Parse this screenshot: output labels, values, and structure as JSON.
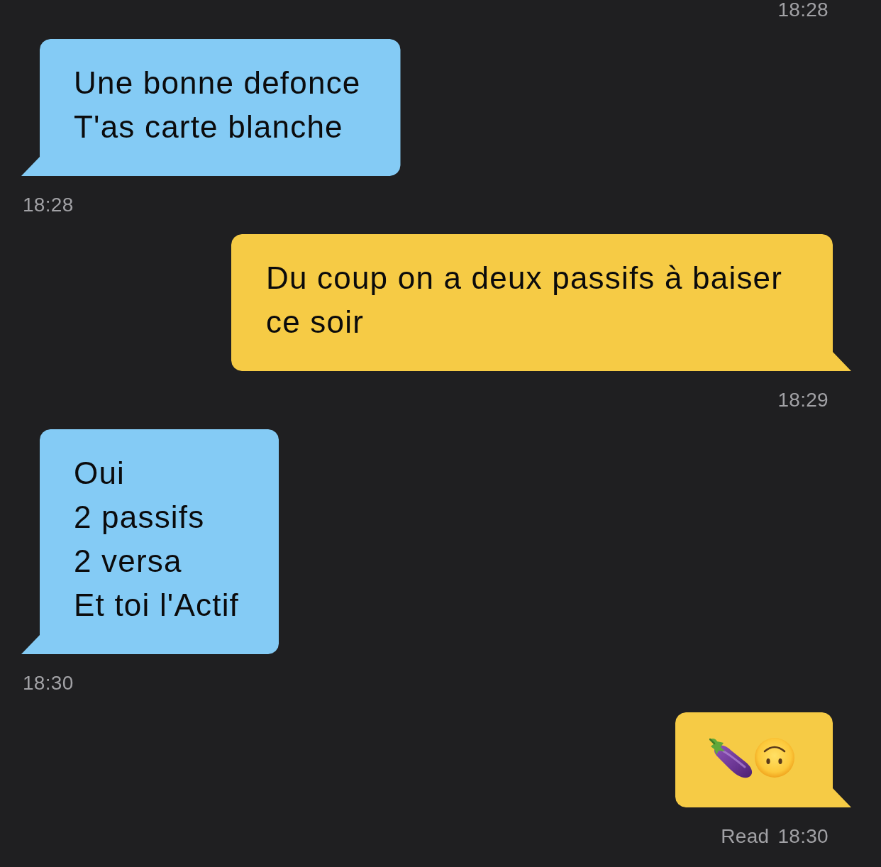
{
  "messages": [
    {
      "outgoing": true,
      "time": "18:28"
    },
    {
      "outgoing": false,
      "text": "Une bonne defonce\nT'as carte blanche",
      "time": "18:28"
    },
    {
      "outgoing": true,
      "text": "Du coup on a deux passifs à baiser ce soir",
      "time": "18:29"
    },
    {
      "outgoing": false,
      "text": "Oui\n2 passifs\n2 versa\nEt toi l'Actif",
      "time": "18:30"
    },
    {
      "outgoing": true,
      "emoji": [
        {
          "kind": "eggplant"
        },
        {
          "kind": "upside-down-face"
        }
      ],
      "status": "Read",
      "time": "18:30"
    }
  ]
}
